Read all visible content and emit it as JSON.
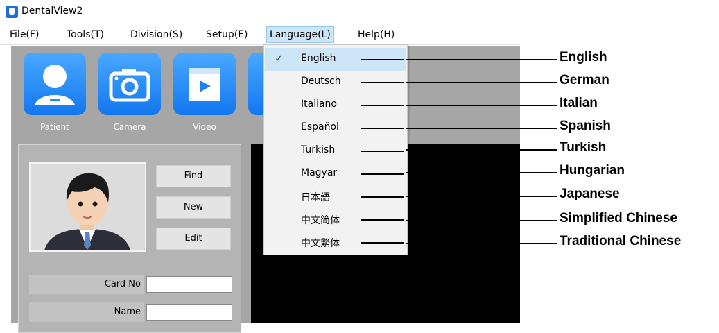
{
  "window": {
    "title": "DentalView2",
    "icon": "tooth-app-icon"
  },
  "menubar": {
    "items": [
      {
        "label": "File(F)"
      },
      {
        "label": "Tools(T)"
      },
      {
        "label": "Division(S)"
      },
      {
        "label": "Setup(E)"
      },
      {
        "label": "Language(L)",
        "active": true
      },
      {
        "label": "Help(H)"
      }
    ]
  },
  "toolbar": {
    "buttons": [
      {
        "label": "Patient",
        "icon": "user-icon"
      },
      {
        "label": "Camera",
        "icon": "camera-icon"
      },
      {
        "label": "Video",
        "icon": "video-icon"
      }
    ]
  },
  "patient_panel": {
    "find_label": "Find",
    "new_label": "New",
    "edit_label": "Edit",
    "card_no_label": "Card No",
    "card_no_value": "",
    "name_label": "Name",
    "name_value": ""
  },
  "language_menu": {
    "items": [
      {
        "label": "English",
        "checked": true
      },
      {
        "label": "Deutsch"
      },
      {
        "label": "Italiano"
      },
      {
        "label": "Español"
      },
      {
        "label": "Turkish"
      },
      {
        "label": "Magyar"
      },
      {
        "label": "日本語"
      },
      {
        "label": "中文简体"
      },
      {
        "label": "中文繁体"
      }
    ]
  },
  "annotations": [
    "English",
    "German",
    "Italian",
    "Spanish",
    "Turkish",
    "Hungarian",
    "Japanese",
    "Simplified Chinese",
    "Traditional Chinese"
  ],
  "colors": {
    "accent_blue": "#1e7bf0",
    "menu_highlight": "#cde6f7",
    "app_background": "#a6a6a6",
    "viewer_background": "#000000"
  }
}
